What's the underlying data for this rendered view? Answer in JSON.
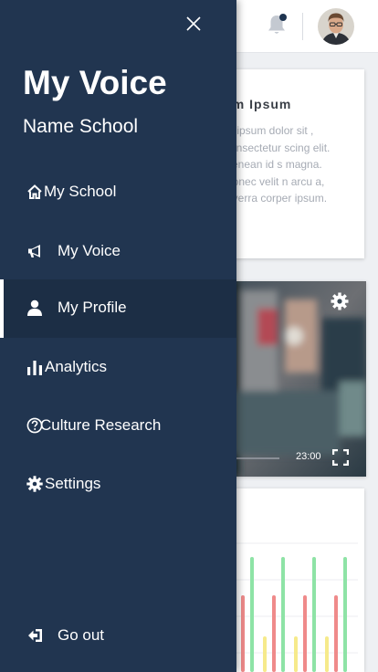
{
  "drawer": {
    "title": "My Voice",
    "school": "Name School",
    "items": [
      {
        "label": "My School",
        "icon": "home-icon",
        "active": false
      },
      {
        "label": "My Voice",
        "icon": "megaphone-icon",
        "active": false
      },
      {
        "label": "My Profile",
        "icon": "user-icon",
        "active": true
      },
      {
        "label": "Analytics",
        "icon": "bar-chart-icon",
        "active": false
      },
      {
        "label": "Culture Research",
        "icon": "question-circle-icon",
        "active": false
      },
      {
        "label": "Settings",
        "icon": "gear-icon",
        "active": false
      }
    ],
    "logout": {
      "label": "Go out",
      "icon": "sign-out-icon"
    }
  },
  "background": {
    "card": {
      "title": "em Ipsum",
      "body": "m ipsum dolor sit , consectetur scing elit. Aenean id s magna. Donec velit n arcu a, viverra corper ipsum."
    },
    "video": {
      "time": "23:00"
    }
  },
  "colors": {
    "drawer_bg": "#213550",
    "active_bg": "#1c2e45",
    "chart_green": "#8ee3a6",
    "chart_red": "#ef8a8a",
    "chart_yellow": "#f6ea8b"
  }
}
